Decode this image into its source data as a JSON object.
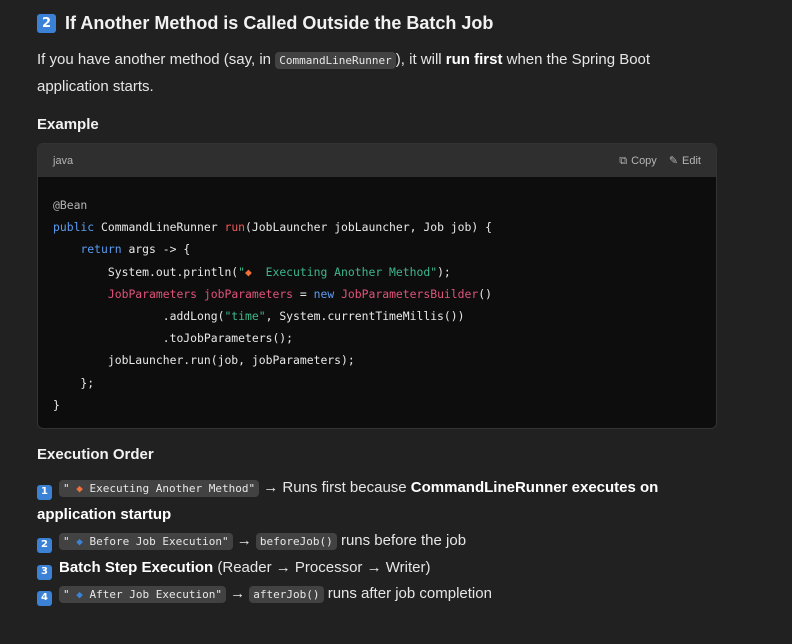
{
  "heading": {
    "number": "2",
    "title": "If Another Method is Called Outside the Batch Job"
  },
  "intro": {
    "t1": "If you have another method (say, in ",
    "code": "CommandLineRunner",
    "t2": "), it will ",
    "bold": "run first",
    "t3": " when the Spring Boot application starts."
  },
  "example_heading": "Example",
  "codeblock": {
    "language": "java",
    "copy_label": "Copy",
    "edit_label": "Edit",
    "lines": [
      "@Bean",
      "public CommandLineRunner run(JobLauncher jobLauncher, Job job) {",
      "    return args -> {",
      "        System.out.println(\"🔸 Executing Another Method\");",
      "        JobParameters jobParameters = new JobParametersBuilder()",
      "                .addLong(\"time\", System.currentTimeMillis())",
      "                .toJobParameters();",
      "        jobLauncher.run(job, jobParameters);",
      "    };",
      "}"
    ]
  },
  "execution_heading": "Execution Order",
  "order": [
    {
      "num": "1",
      "code": "\"🔸 Executing Another Method\"",
      "arrow": " → Runs first because ",
      "bold": "CommandLineRunner executes on application startup"
    },
    {
      "num": "2",
      "code": "\"🔹 Before Job Execution\"",
      "arrow": " → ",
      "code2": "beforeJob()",
      "rest": " runs before the job"
    },
    {
      "num": "3",
      "bold": "Batch Step Execution",
      "rest": " (Reader → Processor → Writer)"
    },
    {
      "num": "4",
      "code": "\"🔹 After Job Execution\"",
      "arrow": " → ",
      "code2": "afterJob()",
      "rest": " runs after job completion"
    }
  ],
  "colors": {
    "background": "#212121",
    "code_bg": "#0d0d0d",
    "keycap": "#3b82d6",
    "keyword": "#5b9cf0",
    "string": "#3fb68b",
    "type": "#e0537a",
    "function": "#ef5a5a"
  }
}
